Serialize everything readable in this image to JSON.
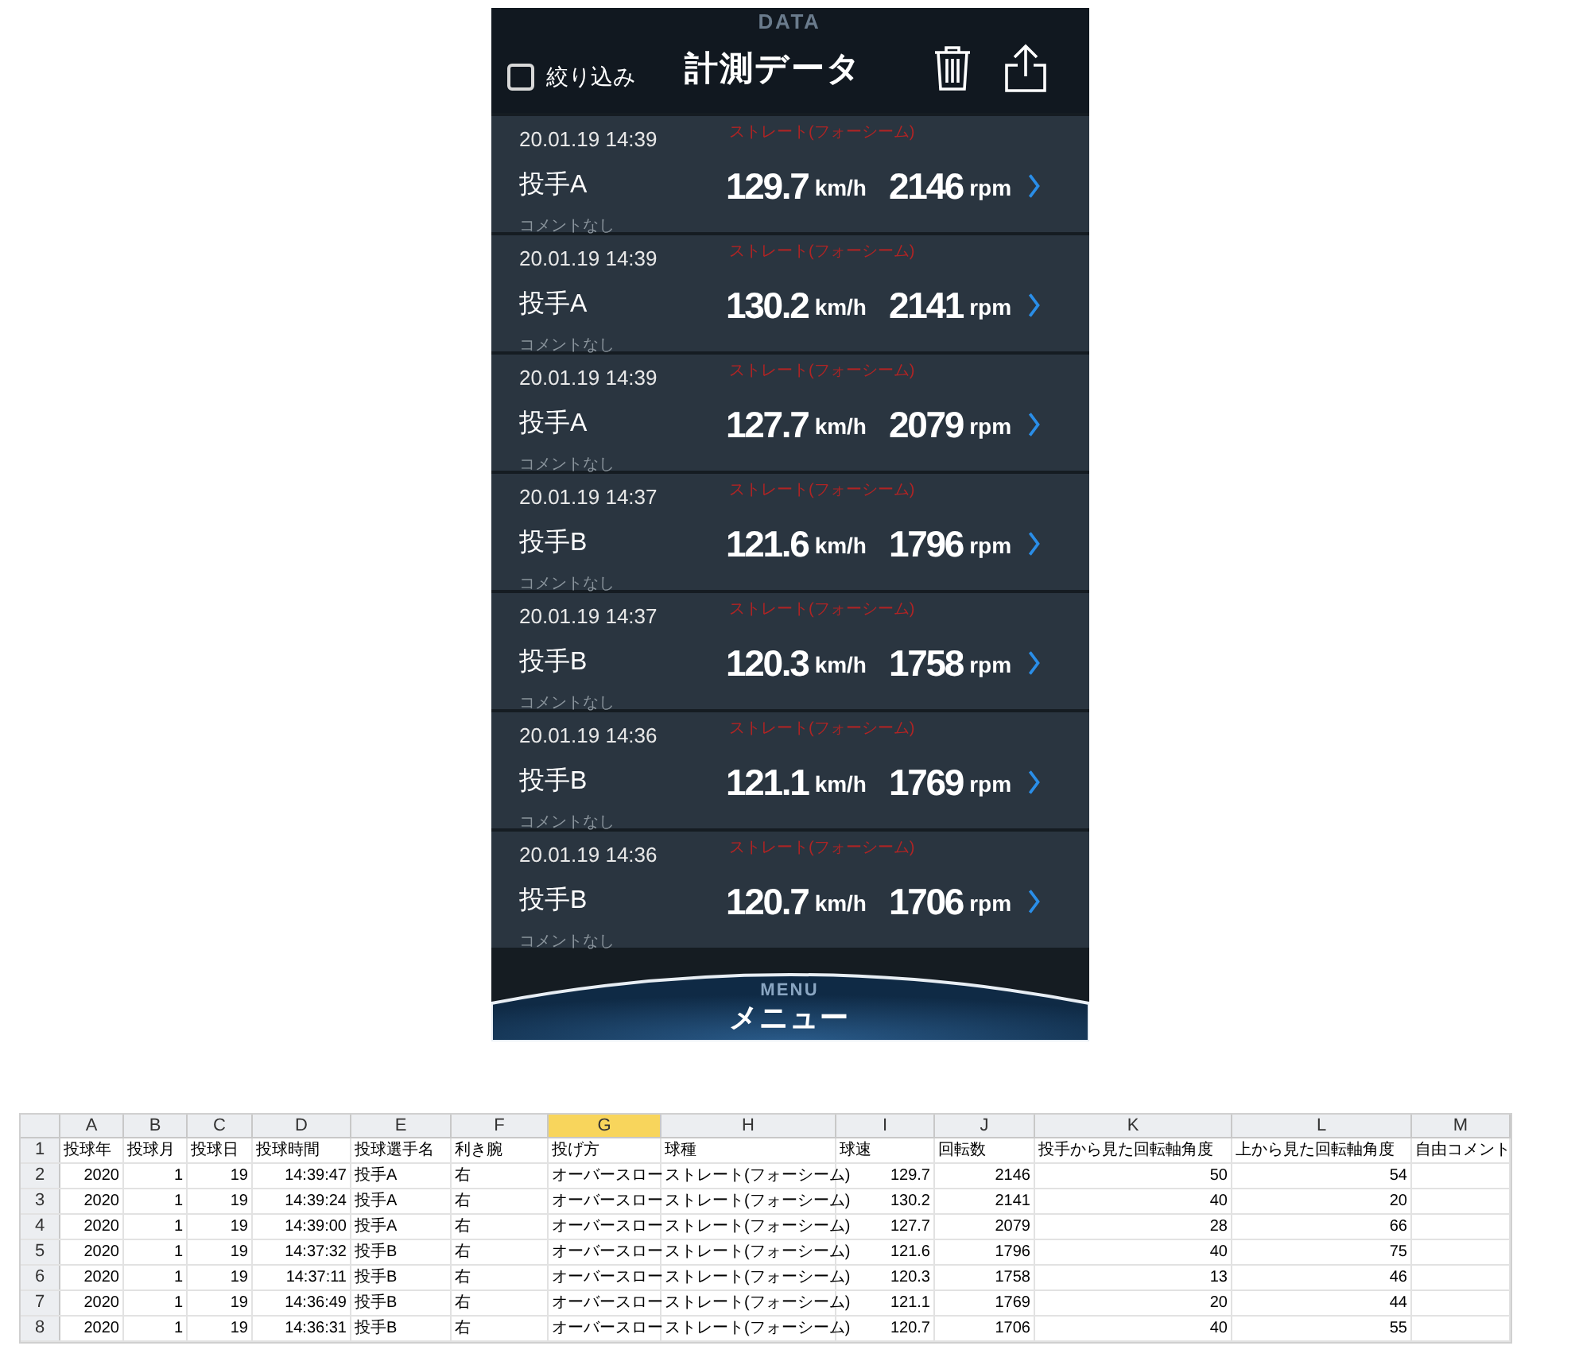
{
  "app": {
    "background_text": "DATA",
    "filter": {
      "label": "絞り込み",
      "checked": false
    },
    "title": "計測データ"
  },
  "records": [
    {
      "datetime": "20.01.19 14:39",
      "pitch_type": "ストレート(フォーシーム)",
      "pitcher": "投手A",
      "speed": "129.7",
      "speed_unit": "km/h",
      "spin": "2146",
      "spin_unit": "rpm",
      "comment": "コメントなし"
    },
    {
      "datetime": "20.01.19 14:39",
      "pitch_type": "ストレート(フォーシーム)",
      "pitcher": "投手A",
      "speed": "130.2",
      "speed_unit": "km/h",
      "spin": "2141",
      "spin_unit": "rpm",
      "comment": "コメントなし"
    },
    {
      "datetime": "20.01.19 14:39",
      "pitch_type": "ストレート(フォーシーム)",
      "pitcher": "投手A",
      "speed": "127.7",
      "speed_unit": "km/h",
      "spin": "2079",
      "spin_unit": "rpm",
      "comment": "コメントなし"
    },
    {
      "datetime": "20.01.19 14:37",
      "pitch_type": "ストレート(フォーシーム)",
      "pitcher": "投手B",
      "speed": "121.6",
      "speed_unit": "km/h",
      "spin": "1796",
      "spin_unit": "rpm",
      "comment": "コメントなし"
    },
    {
      "datetime": "20.01.19 14:37",
      "pitch_type": "ストレート(フォーシーム)",
      "pitcher": "投手B",
      "speed": "120.3",
      "speed_unit": "km/h",
      "spin": "1758",
      "spin_unit": "rpm",
      "comment": "コメントなし"
    },
    {
      "datetime": "20.01.19 14:36",
      "pitch_type": "ストレート(フォーシーム)",
      "pitcher": "投手B",
      "speed": "121.1",
      "speed_unit": "km/h",
      "spin": "1769",
      "spin_unit": "rpm",
      "comment": "コメントなし"
    },
    {
      "datetime": "20.01.19 14:36",
      "pitch_type": "ストレート(フォーシーム)",
      "pitcher": "投手B",
      "speed": "120.7",
      "speed_unit": "km/h",
      "spin": "1706",
      "spin_unit": "rpm",
      "comment": "コメントなし"
    }
  ],
  "menu": {
    "background_text": "MENU",
    "label": "メニュー"
  },
  "spreadsheet": {
    "columns": [
      {
        "letter": "A",
        "selected": false
      },
      {
        "letter": "B",
        "selected": false
      },
      {
        "letter": "C",
        "selected": false
      },
      {
        "letter": "D",
        "selected": false
      },
      {
        "letter": "E",
        "selected": false
      },
      {
        "letter": "F",
        "selected": false
      },
      {
        "letter": "G",
        "selected": true
      },
      {
        "letter": "H",
        "selected": false
      },
      {
        "letter": "I",
        "selected": false
      },
      {
        "letter": "J",
        "selected": false
      },
      {
        "letter": "K",
        "selected": false
      },
      {
        "letter": "L",
        "selected": false
      },
      {
        "letter": "M",
        "selected": false
      }
    ],
    "rows": [
      {
        "number": "1",
        "cells": [
          "投球年",
          "投球月",
          "投球日",
          "投球時間",
          "投球選手名",
          "利き腕",
          "投げ方",
          "球種",
          "球速",
          "回転数",
          "投手から見た回転軸角度",
          "上から見た回転軸角度",
          "自由コメント"
        ]
      },
      {
        "number": "2",
        "cells": [
          "2020",
          "1",
          "19",
          "14:39:47",
          "投手A",
          "右",
          "オーバースロー",
          "ストレート(フォーシーム)",
          "129.7",
          "2146",
          "50",
          "54",
          ""
        ]
      },
      {
        "number": "3",
        "cells": [
          "2020",
          "1",
          "19",
          "14:39:24",
          "投手A",
          "右",
          "オーバースロー",
          "ストレート(フォーシーム)",
          "130.2",
          "2141",
          "40",
          "20",
          ""
        ]
      },
      {
        "number": "4",
        "cells": [
          "2020",
          "1",
          "19",
          "14:39:00",
          "投手A",
          "右",
          "オーバースロー",
          "ストレート(フォーシーム)",
          "127.7",
          "2079",
          "28",
          "66",
          ""
        ]
      },
      {
        "number": "5",
        "cells": [
          "2020",
          "1",
          "19",
          "14:37:32",
          "投手B",
          "右",
          "オーバースロー",
          "ストレート(フォーシーム)",
          "121.6",
          "1796",
          "40",
          "75",
          ""
        ]
      },
      {
        "number": "6",
        "cells": [
          "2020",
          "1",
          "19",
          "14:37:11",
          "投手B",
          "右",
          "オーバースロー",
          "ストレート(フォーシーム)",
          "120.3",
          "1758",
          "13",
          "46",
          ""
        ]
      },
      {
        "number": "7",
        "cells": [
          "2020",
          "1",
          "19",
          "14:36:49",
          "投手B",
          "右",
          "オーバースロー",
          "ストレート(フォーシーム)",
          "121.1",
          "1769",
          "20",
          "44",
          ""
        ]
      },
      {
        "number": "8",
        "cells": [
          "2020",
          "1",
          "19",
          "14:36:31",
          "投手B",
          "右",
          "オーバースロー",
          "ストレート(フォーシーム)",
          "120.7",
          "1706",
          "40",
          "55",
          ""
        ]
      }
    ]
  }
}
